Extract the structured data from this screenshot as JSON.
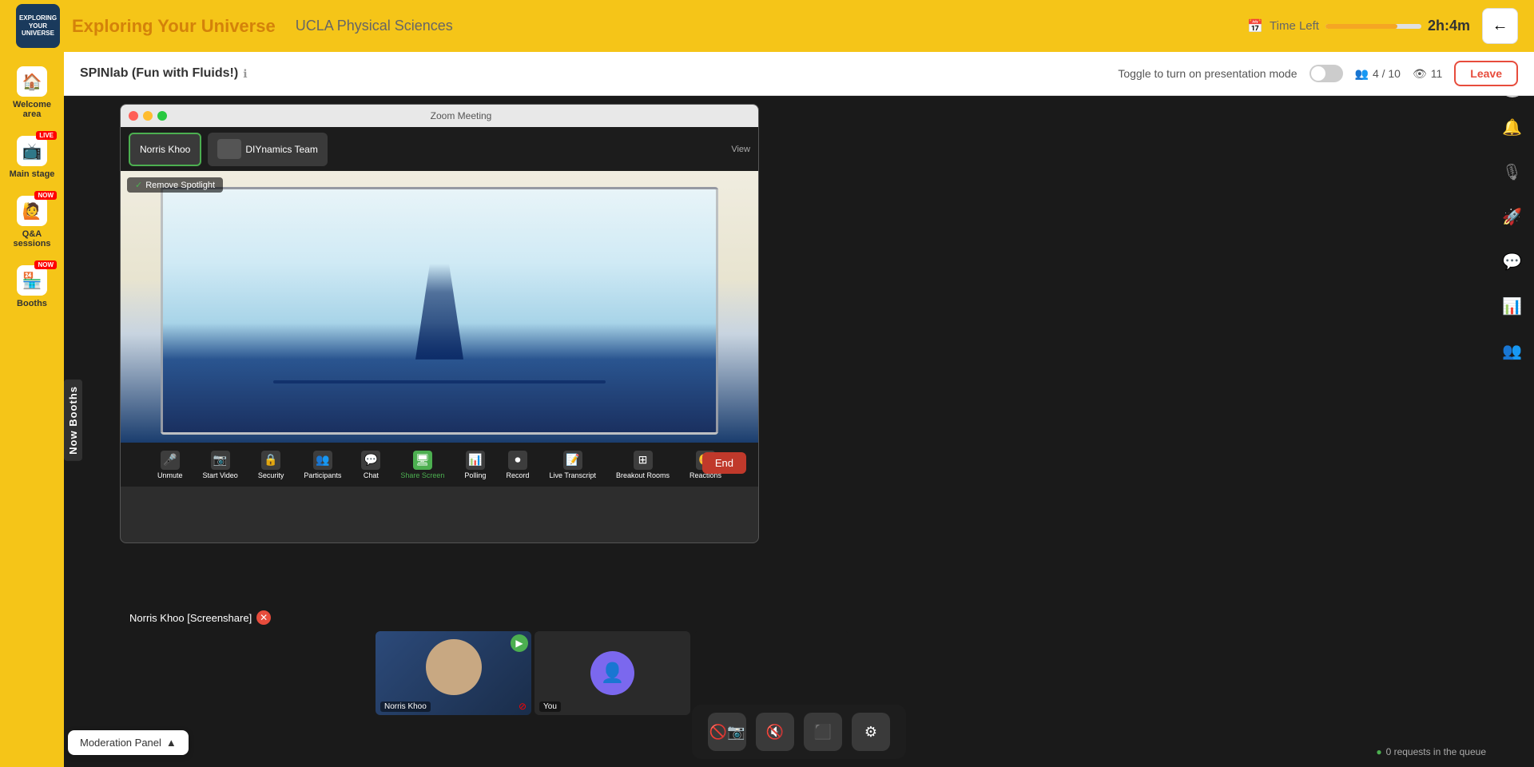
{
  "header": {
    "title": "Exploring Your Universe",
    "subtitle": "UCLA Physical Sciences",
    "time_left_label": "Time Left",
    "time_left_value": "2h:4m",
    "back_icon": "←"
  },
  "sidebar": {
    "items": [
      {
        "id": "welcome",
        "label": "Welcome area",
        "icon": "🏠",
        "badge": null
      },
      {
        "id": "main-stage",
        "label": "Main stage",
        "icon": "📺",
        "badge": "LIVE"
      },
      {
        "id": "qna",
        "label": "Q&A sessions",
        "icon": "🙋",
        "badge": "NOW"
      },
      {
        "id": "booths",
        "label": "Booths",
        "icon": "🏪",
        "badge": "NOW"
      }
    ]
  },
  "session_bar": {
    "title": "SPINlab (Fun with Fluids!)",
    "info_icon": "ℹ",
    "presentation_toggle_label": "Toggle to turn on presentation mode",
    "participants": "4 / 10",
    "viewers": "11",
    "leave_label": "Leave"
  },
  "zoom": {
    "window_title": "Zoom Meeting",
    "participant1": "Norris Khoo",
    "participant2": "DIYnamics Team",
    "view_label": "View",
    "spotlight_label": "Remove Spotlight",
    "controls": [
      {
        "id": "unmute",
        "label": "Unmute",
        "icon": "🎤"
      },
      {
        "id": "startvideo",
        "label": "Start Video",
        "icon": "📷"
      },
      {
        "id": "security",
        "label": "Security",
        "icon": "🔒"
      },
      {
        "id": "participants",
        "label": "Participants",
        "icon": "👥"
      },
      {
        "id": "chat",
        "label": "Chat",
        "icon": "💬"
      },
      {
        "id": "sharesceen",
        "label": "Share Screen",
        "icon": "🖥",
        "active": true
      },
      {
        "id": "polling",
        "label": "Polling",
        "icon": "📊"
      },
      {
        "id": "record",
        "label": "Record",
        "icon": "⏺"
      },
      {
        "id": "livetranscript",
        "label": "Live Transcript",
        "icon": "📝"
      },
      {
        "id": "breakoutrooms",
        "label": "Breakout Rooms",
        "icon": "⊞"
      },
      {
        "id": "reactions",
        "label": "Reactions",
        "icon": "😊"
      }
    ],
    "end_label": "End",
    "participants_row": [
      {
        "id": "norris",
        "name": "Norris Khoo"
      },
      {
        "id": "you",
        "name": "You"
      },
      {
        "id": "extra",
        "name": ""
      }
    ]
  },
  "screenshare": {
    "label": "Norris Khoo [Screenshare]",
    "remove_icon": "✕"
  },
  "now_booths_label": "Now Booths",
  "bottom_controls": {
    "buttons": [
      {
        "id": "video-off",
        "icon": "📷",
        "label": "video off"
      },
      {
        "id": "mic-off",
        "icon": "🎤",
        "label": "mic off"
      },
      {
        "id": "screen",
        "icon": "🖥",
        "label": "screen"
      },
      {
        "id": "settings",
        "icon": "⚙",
        "label": "settings"
      }
    ]
  },
  "right_sidebar": {
    "icons": [
      {
        "id": "user-avatar",
        "icon": "👤"
      },
      {
        "id": "bell",
        "icon": "🔔"
      },
      {
        "id": "mic-right",
        "icon": "🎙"
      },
      {
        "id": "rocket",
        "icon": "🚀"
      },
      {
        "id": "chat-right",
        "icon": "💬"
      },
      {
        "id": "chart-right",
        "icon": "📊"
      },
      {
        "id": "people-right",
        "icon": "👥"
      }
    ]
  },
  "moderation_panel": {
    "label": "Moderation Panel",
    "arrow": "▲"
  },
  "queue_status": {
    "icon": "●",
    "text": "0 requests in the queue"
  }
}
